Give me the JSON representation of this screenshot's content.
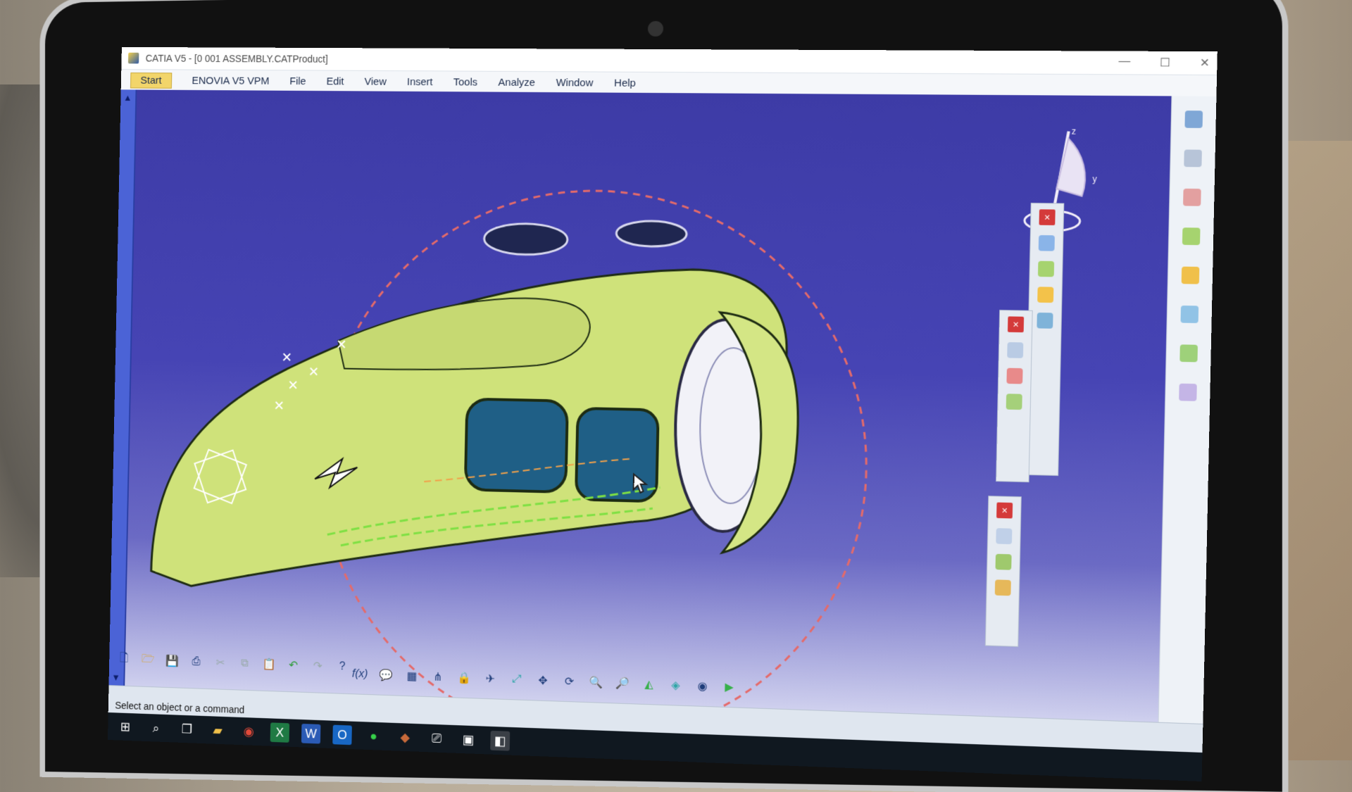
{
  "window": {
    "title": "CATIA V5 - [0 001 ASSEMBLY.CATProduct]"
  },
  "menu": {
    "items": [
      "Start",
      "ENOVIA V5 VPM",
      "File",
      "Edit",
      "View",
      "Insert",
      "Tools",
      "Analyze",
      "Window",
      "Help"
    ]
  },
  "status_bar": {
    "message": "Select an object or a command"
  },
  "compass": {
    "z_label": "z",
    "y_label": "y"
  },
  "colors": {
    "viewport_top": "#3d3ba6",
    "part_fill": "#cfe27a",
    "accent_red": "#d43a3a",
    "start_yellow": "#f2d56a"
  },
  "icons": {
    "bottom_toolbar": [
      "new-icon",
      "open-icon",
      "save-icon",
      "print-icon",
      "cut-icon",
      "copy-icon",
      "paste-icon",
      "undo-icon",
      "redo-icon",
      "whats-this-icon"
    ],
    "bottom_toolbar2": [
      "formula-icon",
      "comment-icon",
      "catalog-icon",
      "table-icon",
      "tree-icon",
      "lock-icon",
      "fly-icon",
      "fit-all-icon",
      "pan-icon",
      "rotate-icon",
      "zoom-in-icon",
      "zoom-out-icon",
      "normal-view-icon",
      "iso-view-icon",
      "shading-icon",
      "hide-show-icon"
    ],
    "taskbar": [
      "windows-icon",
      "search-icon",
      "task-view-icon",
      "file-explorer-icon",
      "chrome-icon",
      "excel-icon",
      "word-icon",
      "outlook-icon",
      "app-icon",
      "app-icon-2",
      "app-icon-3",
      "app-icon-4",
      "catia-icon"
    ]
  }
}
